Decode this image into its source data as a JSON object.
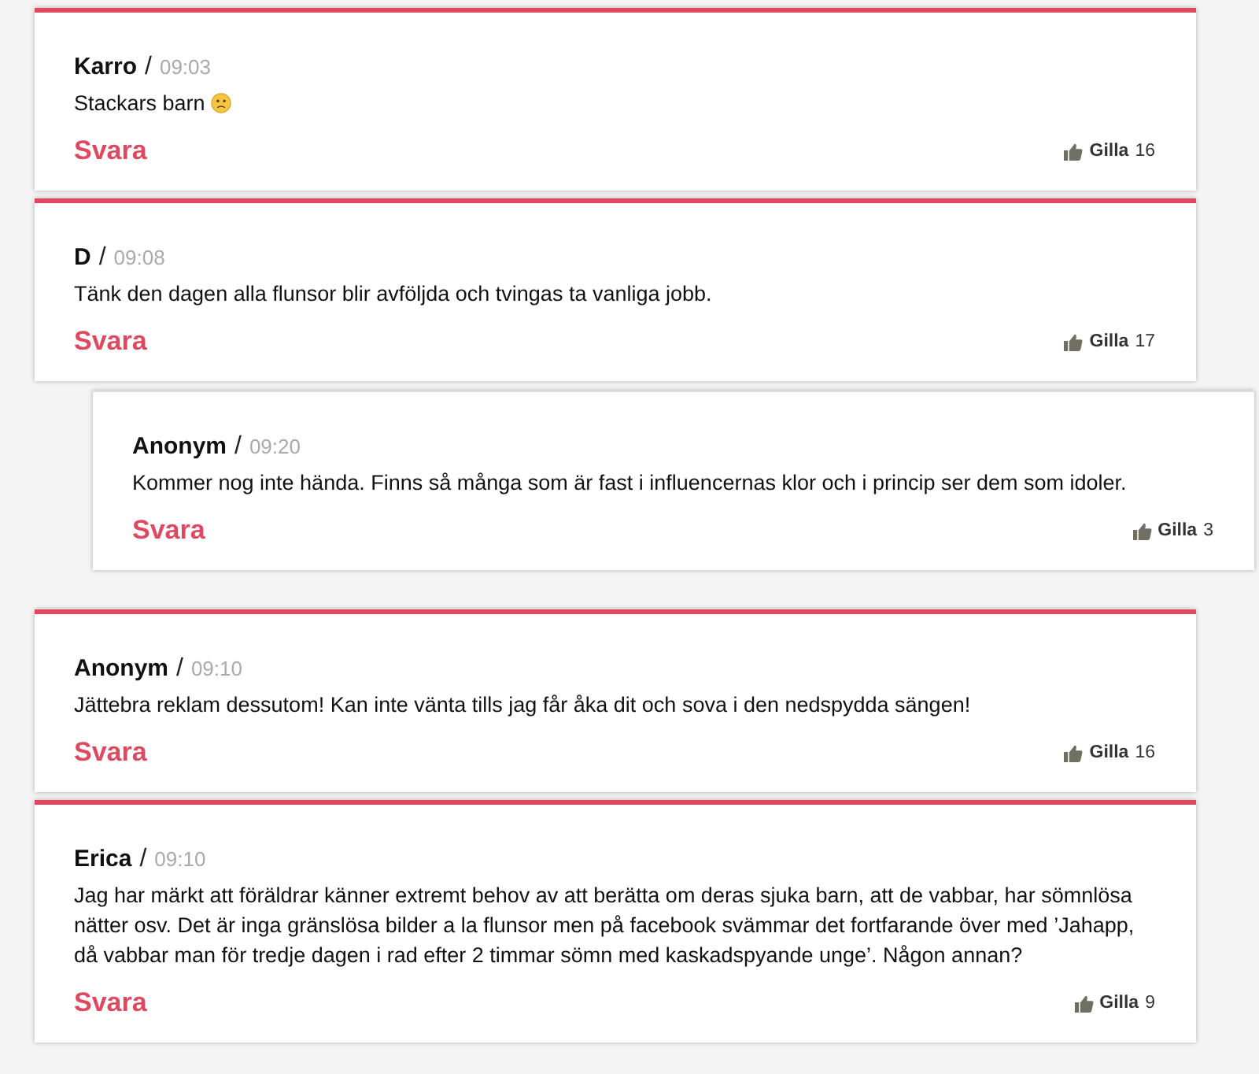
{
  "comments": [
    {
      "author": "Karro",
      "separator": "/",
      "time": "09:03",
      "text": "Stackars barn",
      "emoji": true,
      "reply_label": "Svara",
      "like_label": "Gilla",
      "likes": "16"
    },
    {
      "author": "D",
      "separator": "/",
      "time": "09:08",
      "text": "Tänk den dagen alla flunsor blir avföljda och tvingas ta vanliga jobb.",
      "reply_label": "Svara",
      "like_label": "Gilla",
      "likes": "17",
      "children": [
        {
          "author": "Anonym",
          "separator": "/",
          "time": "09:20",
          "text": "Kommer nog inte hända. Finns så många som är fast i influencernas klor och i princip ser dem som idoler.",
          "reply_label": "Svara",
          "like_label": "Gilla",
          "likes": "3"
        }
      ]
    },
    {
      "author": "Anonym",
      "separator": "/",
      "time": "09:10",
      "text": "Jättebra reklam dessutom! Kan inte vänta tills jag får åka dit och sova i den nedspydda sängen!",
      "reply_label": "Svara",
      "like_label": "Gilla",
      "likes": "16"
    },
    {
      "author": "Erica",
      "separator": "/",
      "time": "09:10",
      "text": "Jag har märkt att föräldrar känner extremt behov av att berätta om deras sjuka barn, att de vabbar, har sömnlösa nätter osv. Det är inga gränslösa bilder a la flunsor men på facebook svämmar det fortfarande över med ’Jahapp, då vabbar man för tredje dagen i rad efter 2 timmar sömn med kaskadspyande unge’. Någon annan?",
      "reply_label": "Svara",
      "like_label": "Gilla",
      "likes": "9"
    }
  ]
}
